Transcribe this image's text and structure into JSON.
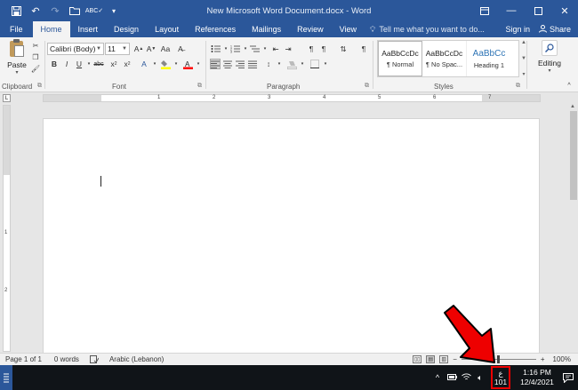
{
  "window": {
    "title": "New Microsoft Word Document.docx - Word"
  },
  "tabs": [
    {
      "label": "File"
    },
    {
      "label": "Home"
    },
    {
      "label": "Insert"
    },
    {
      "label": "Design"
    },
    {
      "label": "Layout"
    },
    {
      "label": "References"
    },
    {
      "label": "Mailings"
    },
    {
      "label": "Review"
    },
    {
      "label": "View"
    }
  ],
  "tell_me": "Tell me what you want to do...",
  "account": {
    "sign_in": "Sign in",
    "share": "Share"
  },
  "ribbon": {
    "clipboard": {
      "paste_label": "Paste",
      "group_label": "Clipboard"
    },
    "font": {
      "font_name": "Calibri (Body)",
      "font_size": "11",
      "group_label": "Font"
    },
    "paragraph": {
      "group_label": "Paragraph"
    },
    "styles": {
      "group_label": "Styles",
      "items": [
        {
          "sample": "AaBbCcDc",
          "name": "¶ Normal"
        },
        {
          "sample": "AaBbCcDc",
          "name": "¶ No Spac..."
        },
        {
          "sample": "AaBbCc",
          "name": "Heading 1"
        }
      ]
    },
    "editing": {
      "label": "Editing"
    }
  },
  "ruler": {
    "numbers": [
      "1",
      "2",
      "3",
      "4",
      "5",
      "6",
      "7"
    ]
  },
  "vertical_ruler": {
    "numbers": [
      "1",
      "2"
    ]
  },
  "status": {
    "page": "Page 1 of 1",
    "words": "0 words",
    "language": "Arabic (Lebanon)",
    "zoom": "100%",
    "zoom_level": 1.0
  },
  "taskbar": {
    "ime_top": "ع",
    "ime_bottom": "101",
    "time": "1:16 PM",
    "date": "12/4/2021"
  },
  "colors": {
    "word_blue": "#2b579a",
    "annotation_red": "#ee0000",
    "highlight_yellow": "#ffff00",
    "font_red": "#ff0000"
  }
}
